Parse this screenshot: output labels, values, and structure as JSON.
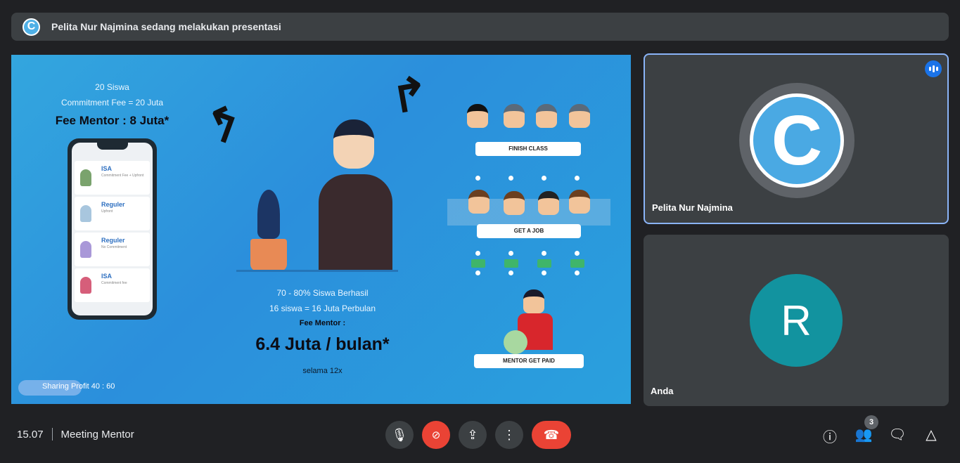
{
  "banner": {
    "text": "Pelita Nur Najmina sedang melakukan presentasi"
  },
  "slide": {
    "left": {
      "line1": "20 Siswa",
      "line2": "Commitment Fee = 20 Juta",
      "fee": "Fee Mentor : 8 Juta*"
    },
    "phone_cards": [
      {
        "title": "ISA",
        "sub": "Commitment Fee + Upfront"
      },
      {
        "title": "Reguler",
        "sub": "Upfront"
      },
      {
        "title": "Reguler",
        "sub": "No Commitment"
      },
      {
        "title": "ISA",
        "sub": "Commitment fee"
      }
    ],
    "center": {
      "line1": "70 - 80% Siswa Berhasil",
      "line2": "16 siswa = 16 Juta Perbulan",
      "fee_label": "Fee Mentor :",
      "fee_value": "6.4 Juta / bulan*",
      "duration": "selama 12x"
    },
    "footer": "Sharing Profit 40 : 60",
    "flow": {
      "step1": "FINISH CLASS",
      "step2": "GET A JOB",
      "step3": "MENTOR GET PAID"
    }
  },
  "participants": [
    {
      "name": "Pelita Nur Najmina",
      "initial": "C",
      "speaking": true
    },
    {
      "name": "Anda",
      "initial": "R",
      "color": "#12939f"
    }
  ],
  "bottom": {
    "time": "15.07",
    "meeting": "Meeting Mentor",
    "participant_count": "3"
  },
  "colors": {
    "accent": "#8ab4f8",
    "end_call": "#ea4335",
    "bg": "#202124"
  }
}
